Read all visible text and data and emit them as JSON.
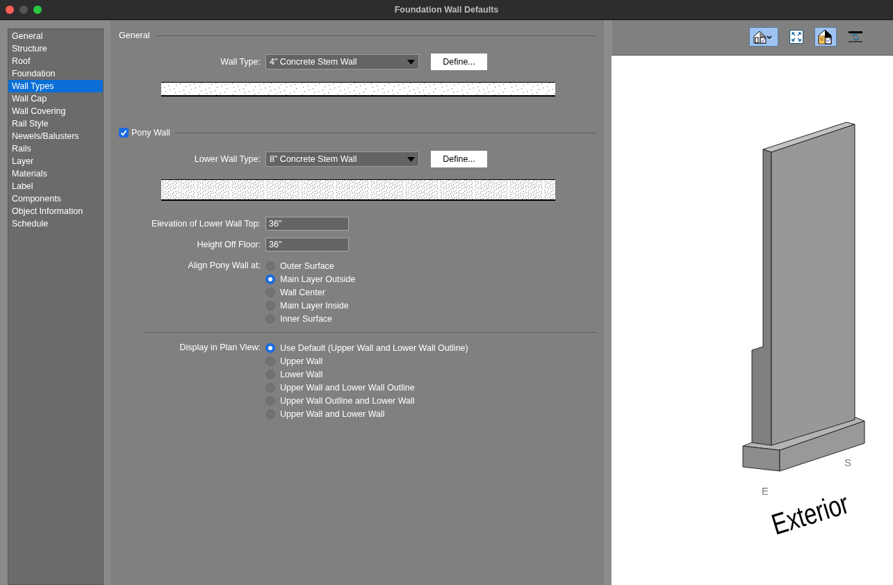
{
  "window": {
    "title": "Foundation Wall Defaults"
  },
  "sidebar": {
    "items": [
      {
        "label": "General",
        "selected": false
      },
      {
        "label": "Structure",
        "selected": false
      },
      {
        "label": "Roof",
        "selected": false
      },
      {
        "label": "Foundation",
        "selected": false
      },
      {
        "label": "Wall Types",
        "selected": true
      },
      {
        "label": "Wall Cap",
        "selected": false
      },
      {
        "label": "Wall Covering",
        "selected": false
      },
      {
        "label": "Rail Style",
        "selected": false
      },
      {
        "label": "Newels/Balusters",
        "selected": false
      },
      {
        "label": "Rails",
        "selected": false
      },
      {
        "label": "Layer",
        "selected": false
      },
      {
        "label": "Materials",
        "selected": false
      },
      {
        "label": "Label",
        "selected": false
      },
      {
        "label": "Components",
        "selected": false
      },
      {
        "label": "Object Information",
        "selected": false
      },
      {
        "label": "Schedule",
        "selected": false
      }
    ]
  },
  "general": {
    "heading": "General",
    "wall_type": {
      "label": "Wall Type:",
      "value": "4\" Concrete Stem Wall",
      "button": "Define..."
    }
  },
  "pony_wall": {
    "label": "Pony Wall",
    "checked": true,
    "lower_wall_type": {
      "label": "Lower Wall Type:",
      "value": "8\" Concrete Stem Wall",
      "button": "Define..."
    },
    "fields": [
      {
        "label": "Elevation of Lower Wall Top:",
        "value": "36\""
      },
      {
        "label": "Height Off Floor:",
        "value": "36\""
      }
    ],
    "align": {
      "label": "Align Pony Wall at:",
      "options": [
        {
          "label": "Outer Surface",
          "selected": false
        },
        {
          "label": "Main Layer Outside",
          "selected": true
        },
        {
          "label": "Wall Center",
          "selected": false
        },
        {
          "label": "Main Layer Inside",
          "selected": false
        },
        {
          "label": "Inner Surface",
          "selected": false
        }
      ]
    },
    "display": {
      "label": "Display in Plan View:",
      "options": [
        {
          "label": "Use Default (Upper Wall and Lower Wall Outline)",
          "selected": true
        },
        {
          "label": "Upper Wall",
          "selected": false
        },
        {
          "label": "Lower Wall",
          "selected": false
        },
        {
          "label": "Upper Wall and Lower Wall Outline",
          "selected": false
        },
        {
          "label": "Upper Wall Outline and Lower Wall",
          "selected": false
        },
        {
          "label": "Upper Wall and Lower Wall",
          "selected": false
        }
      ]
    }
  },
  "preview": {
    "toolbar": [
      {
        "kind": "house",
        "selected": true
      },
      {
        "kind": "fit",
        "selected": false
      },
      {
        "kind": "housecolor",
        "selected": true
      },
      {
        "kind": "refresh",
        "selected": false
      }
    ],
    "labels": {
      "east": "E",
      "south": "S",
      "side": "Exterior"
    }
  }
}
